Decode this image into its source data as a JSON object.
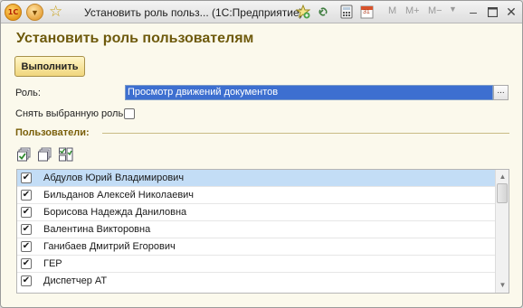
{
  "titlebar": {
    "logo_text": "1С",
    "title": "Установить роль польз...  (1С:Предприятие)",
    "m_label": "M",
    "mplus_label": "M+",
    "mminus_label": "M−",
    "calendar_day": "31"
  },
  "form": {
    "title": "Установить роль пользователям",
    "run_button": "Выполнить",
    "role_label": "Роль:",
    "role_value": "Просмотр движений документов",
    "role_pick": "...",
    "clear_role_label": "Снять выбранную роль:",
    "clear_role_checked": false,
    "users_group_title": "Пользователи:"
  },
  "users": {
    "rows": [
      {
        "name": "Абдулов Юрий Владимирович",
        "checked": true,
        "selected": true
      },
      {
        "name": "Бильданов Алексей Николаевич",
        "checked": true,
        "selected": false
      },
      {
        "name": "Борисова Надежда Даниловна",
        "checked": true,
        "selected": false
      },
      {
        "name": "Валентина Викторовна",
        "checked": true,
        "selected": false
      },
      {
        "name": "Ганибаев Дмитрий Егорович",
        "checked": true,
        "selected": false
      },
      {
        "name": "ГЕР",
        "checked": true,
        "selected": false
      },
      {
        "name": "Диспетчер АТ",
        "checked": true,
        "selected": false
      }
    ]
  },
  "colors": {
    "title_text": "#6e5a0c",
    "selection": "#c3ddf6",
    "role_highlight": "#3d6fd0"
  },
  "icons": {
    "logo": "1c-logo-icon",
    "menu": "main-menu-icon",
    "favorite": "star-icon",
    "check_all": "check-all-icon",
    "uncheck_all": "uncheck-all-icon",
    "toggle": "invert-checks-icon"
  }
}
